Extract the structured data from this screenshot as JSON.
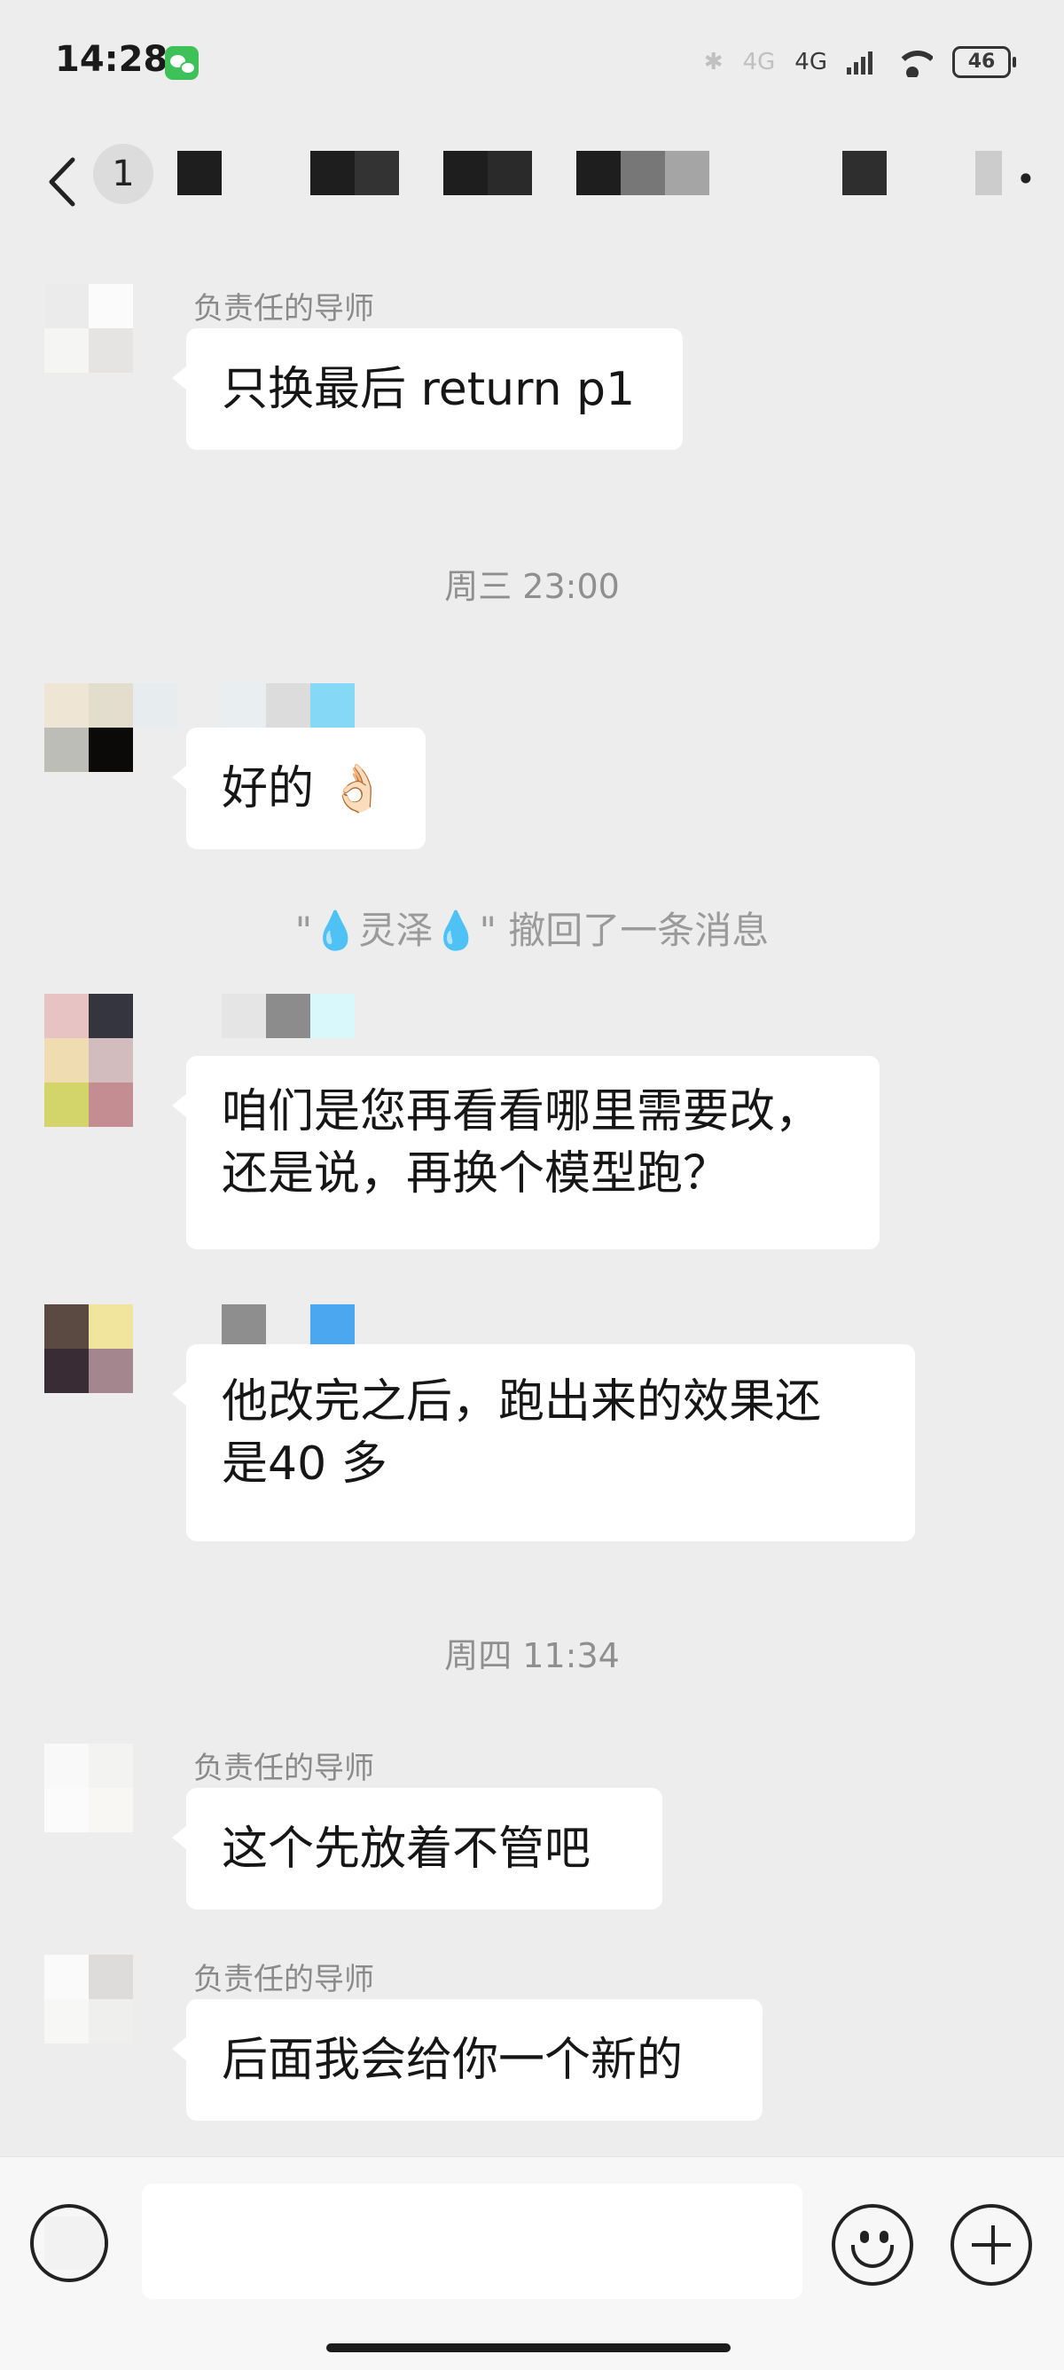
{
  "status_bar": {
    "time": "14:28",
    "network_1": "4G",
    "network_2": "4G",
    "battery": "46"
  },
  "nav": {
    "unread_count": "1"
  },
  "messages": [
    {
      "sender": "负责任的导师",
      "text": "只换最后 return p1"
    },
    {
      "timestamp": "周三 23:00"
    },
    {
      "sender": "",
      "text": "好的 👌🏻"
    },
    {
      "system": {
        "prefix": "\"",
        "name": "灵泽",
        "suffix": "\" 撤回了一条消息"
      }
    },
    {
      "sender": "",
      "text_line1": "咱们是您再看看哪里需要改，",
      "text_line2": "还是说，再换个模型跑？"
    },
    {
      "sender": "",
      "text_line1": "他改完之后，跑出来的效果还",
      "text_line2": "是40 多"
    },
    {
      "timestamp": "周四 11:34"
    },
    {
      "sender": "负责任的导师",
      "text": "这个先放着不管吧"
    },
    {
      "sender": "负责任的导师",
      "text": "后面我会给你一个新的"
    }
  ],
  "system_drop_icon": "💧",
  "input_bar": {
    "voice_icon": "voice-icon",
    "emoji_icon": "emoji-icon",
    "plus_icon": "plus-icon"
  }
}
